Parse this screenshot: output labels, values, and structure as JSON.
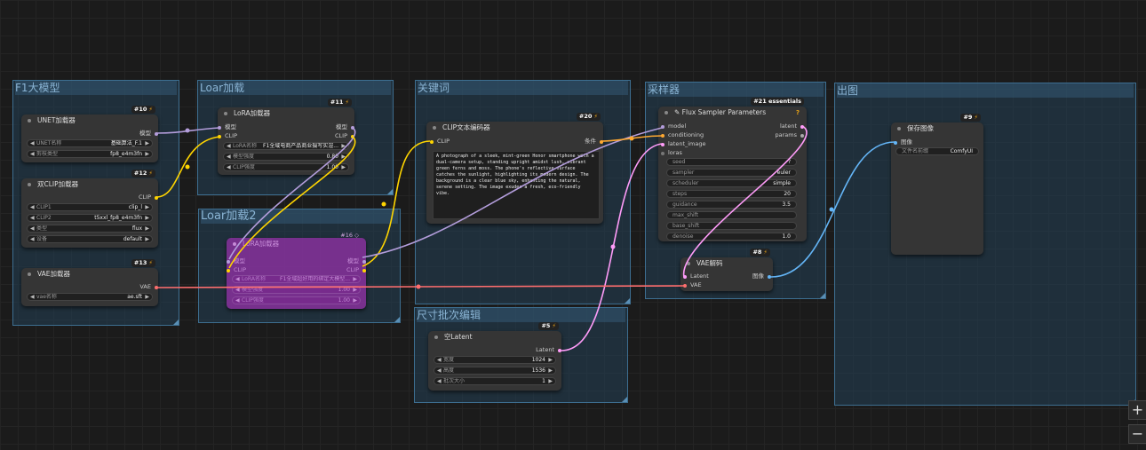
{
  "groups": {
    "f1": "F1大模型",
    "lora": "Loar加载",
    "lora2": "Loar加载2",
    "keywords": "关键词",
    "sampler": "采样器",
    "output": "出图",
    "size": "尺寸批次编辑"
  },
  "nodes": {
    "unet": {
      "id": "#10",
      "title": "UNET加载器",
      "out": "模型",
      "w1": {
        "label": "UNET名称",
        "value": "基础算法_F.1"
      },
      "w2": {
        "label": "剪枝类型",
        "value": "fp8_e4m3fn"
      }
    },
    "dualclip": {
      "id": "#12",
      "title": "双CLIP加载器",
      "out": "CLIP",
      "w1": {
        "label": "CLIP1",
        "value": "clip_l"
      },
      "w2": {
        "label": "CLIP2",
        "value": "t5xxl_fp8_e4m3fn"
      },
      "w3": {
        "label": "类型",
        "value": "flux"
      },
      "w4": {
        "label": "设备",
        "value": "default"
      }
    },
    "vae": {
      "id": "#13",
      "title": "VAE加载器",
      "out": "VAE",
      "w1": {
        "label": "vae名称",
        "value": "ae.sft"
      }
    },
    "lora": {
      "id": "#11",
      "title": "LoRA加载器",
      "in1": "模型",
      "in2": "CLIP",
      "out1": "模型",
      "out2": "CLIP",
      "w1": {
        "label": "LoRA名称",
        "value": "F1全域电商产品商业摄写实渲..."
      },
      "w2": {
        "label": "模型强度",
        "value": "0.80"
      },
      "w3": {
        "label": "CLIP强度",
        "value": "1.00"
      }
    },
    "lora2": {
      "id": "#16",
      "title": "LoRA加载器",
      "in1": "模型",
      "in2": "CLIP",
      "out1": "模型",
      "out2": "CLIP",
      "w1": {
        "label": "LoRA名称",
        "value": "F1全域超好用的绑定大模型..."
      },
      "w2": {
        "label": "模型强度",
        "value": "1.00"
      },
      "w3": {
        "label": "CLIP强度",
        "value": "1.00"
      }
    },
    "clip": {
      "id": "#20",
      "title": "CLIP文本编码器",
      "in": "CLIP",
      "out": "条件",
      "text": "A photograph of a sleek, mint-green Honor smartphone with a dual-camera setup, standing upright amidst lush, vibrant green ferns and moss. The phone's reflective surface catches the sunlight, highlighting its modern design. The background is a clear blue sky, enhancing the natural, serene setting. The image exudes a fresh, eco-friendly vibe."
    },
    "flux": {
      "id": "#21 essentials",
      "title": "Flux Sampler Parameters",
      "in1": "model",
      "in2": "conditioning",
      "in3": "latent_image",
      "in4": "loras",
      "out1": "latent",
      "out2": "params",
      "w": [
        {
          "label": "seed",
          "value": "?"
        },
        {
          "label": "sampler",
          "value": "euler"
        },
        {
          "label": "scheduler",
          "value": "simple"
        },
        {
          "label": "steps",
          "value": "20"
        },
        {
          "label": "guidance",
          "value": "3.5"
        },
        {
          "label": "max_shift",
          "value": ""
        },
        {
          "label": "base_shift",
          "value": ""
        },
        {
          "label": "denoise",
          "value": "1.0"
        }
      ]
    },
    "vaedecode": {
      "id": "#8",
      "title": "VAE解码",
      "in1": "Latent",
      "in2": "VAE",
      "out": "图像"
    },
    "save": {
      "id": "#9",
      "title": "保存图像",
      "in": "图像",
      "w1": {
        "label": "文件名前缀",
        "value": "ComfyUI"
      }
    },
    "latent": {
      "id": "#5",
      "title": "空Latent",
      "out": "Latent",
      "w1": {
        "label": "宽度",
        "value": "1024"
      },
      "w2": {
        "label": "高度",
        "value": "1536"
      },
      "w3": {
        "label": "批次大小",
        "value": "1"
      }
    }
  },
  "zoom": {
    "in": "+",
    "out": "−"
  },
  "colors": {
    "model": "#b39ddb",
    "clip": "#ffd500",
    "vae": "#ff6e6e",
    "conditioning": "#ffa931",
    "latent": "#ff9cf9",
    "image": "#64b5f6"
  }
}
